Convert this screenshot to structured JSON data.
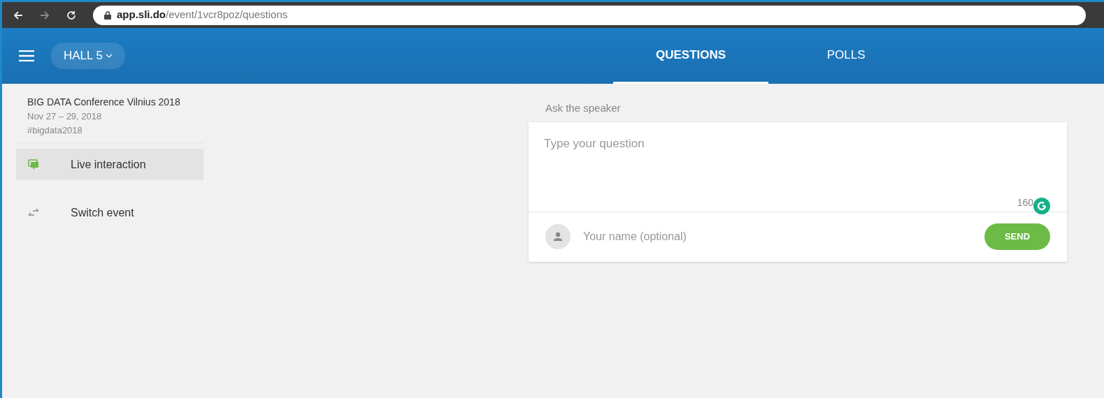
{
  "browser": {
    "url": "**app.sli.do**/event/1vcr8poz/questions"
  },
  "header": {
    "event_switch": "HALL 5",
    "tabs": [
      {
        "label": "QUESTIONS",
        "selected": true
      },
      {
        "label": "POLLS",
        "selected": false
      }
    ]
  },
  "sidebar": {
    "event_name": "BIG DATA Conference Vilnius 2018",
    "dates": "Nov 27 – 29, 2018",
    "hashtag": "#bigdata2018",
    "items": [
      {
        "kind": "chat",
        "label": "Live interaction",
        "selected": true
      },
      {
        "kind": "switch",
        "label": "Switch event",
        "selected": false
      }
    ]
  },
  "main": {
    "section_label": "Ask the speaker",
    "question": {
      "placeholder": "Type your question",
      "counter": "160"
    },
    "name": {
      "placeholder": "Your name (optional)"
    },
    "send": "SEND"
  }
}
